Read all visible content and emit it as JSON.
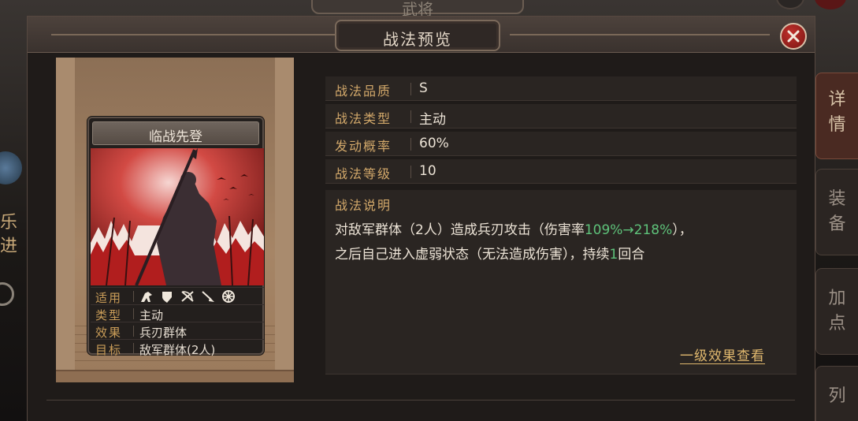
{
  "background": {
    "top_tab_label": "武将",
    "left_text": "乐进",
    "side_tabs": [
      {
        "label": "详情",
        "active": true
      },
      {
        "label": "装备",
        "active": false
      },
      {
        "label": "加点",
        "active": false
      },
      {
        "label": "列",
        "active": false
      }
    ]
  },
  "dialog": {
    "title": "战法预览",
    "close_icon": "close-icon"
  },
  "card": {
    "name": "临战先登",
    "rows": [
      {
        "label": "适用",
        "value": "",
        "icons": [
          "cavalry-icon",
          "shield-icon",
          "bow-icon",
          "spear-icon",
          "chariot-wheel-icon"
        ]
      },
      {
        "label": "类型",
        "value": "主动"
      },
      {
        "label": "效果",
        "value": "兵刃群体"
      },
      {
        "label": "目标",
        "value": "敌军群体(2人)"
      }
    ]
  },
  "stats": [
    {
      "label": "战法品质",
      "value": "S"
    },
    {
      "label": "战法类型",
      "value": "主动"
    },
    {
      "label": "发动概率",
      "value": "60%"
    },
    {
      "label": "战法等级",
      "value": "10"
    }
  ],
  "description": {
    "title": "战法说明",
    "line1_a": "对敌军群体（2人）造成兵刃攻击（伤害率",
    "line1_hl": "109%→218%",
    "line1_b": "），",
    "line2_a": "之后自己进入虚弱状态（无法造成伤害），持续",
    "line2_hl": "1",
    "line2_b": "回合"
  },
  "link_label": "一级效果查看",
  "colors": {
    "highlight": "#5ec27a",
    "label_gold": "#d2a86a",
    "close_red": "#b52a26"
  }
}
